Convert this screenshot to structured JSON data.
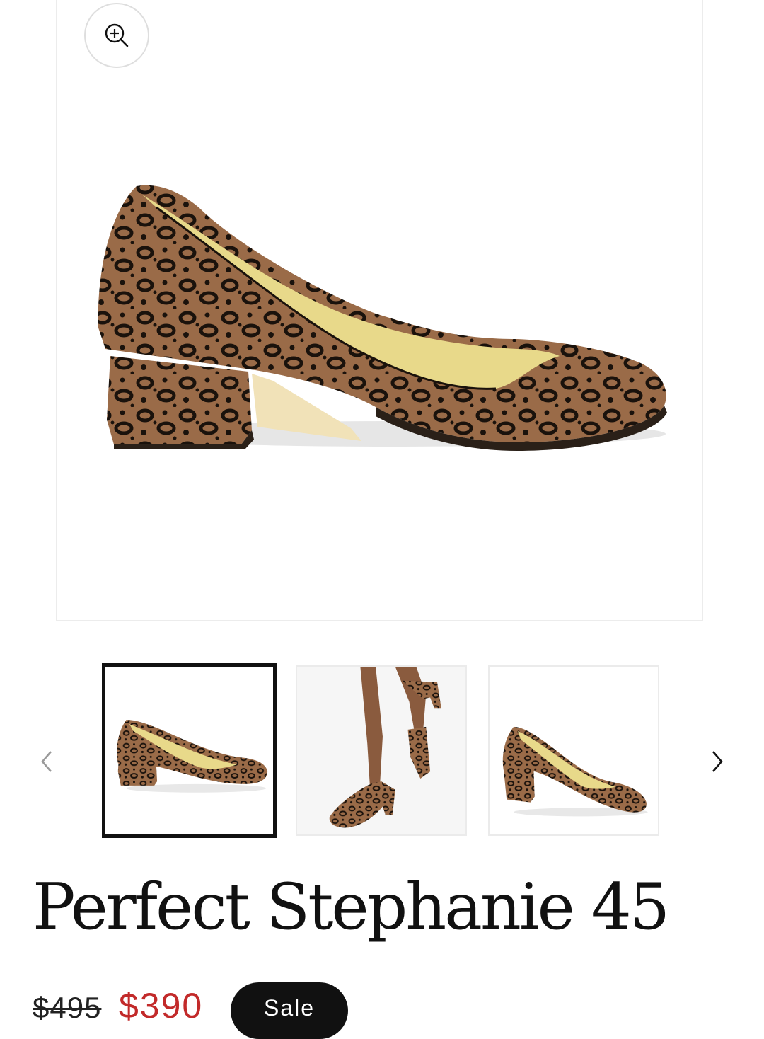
{
  "gallery": {
    "zoom_icon": "zoom-in-icon",
    "main_image_alt": "Perfect Stephanie 45 leopard pump side view",
    "thumbnails": [
      {
        "alt": "Leopard pump side view",
        "active": true
      },
      {
        "alt": "Model wearing leopard pumps",
        "active": false
      },
      {
        "alt": "Leopard pump three-quarter view",
        "active": false
      }
    ],
    "prev_icon": "chevron-left-icon",
    "next_icon": "chevron-right-icon"
  },
  "product": {
    "title": "Perfect Stephanie 45",
    "price_original": "$495",
    "price_sale": "$390",
    "badge": "Sale"
  },
  "colors": {
    "sale_price": "#c22a2a",
    "badge_bg": "#111111",
    "leopard_base": "#9a6b48",
    "leopard_spot": "#1a120c",
    "lining": "#e8d98a"
  }
}
